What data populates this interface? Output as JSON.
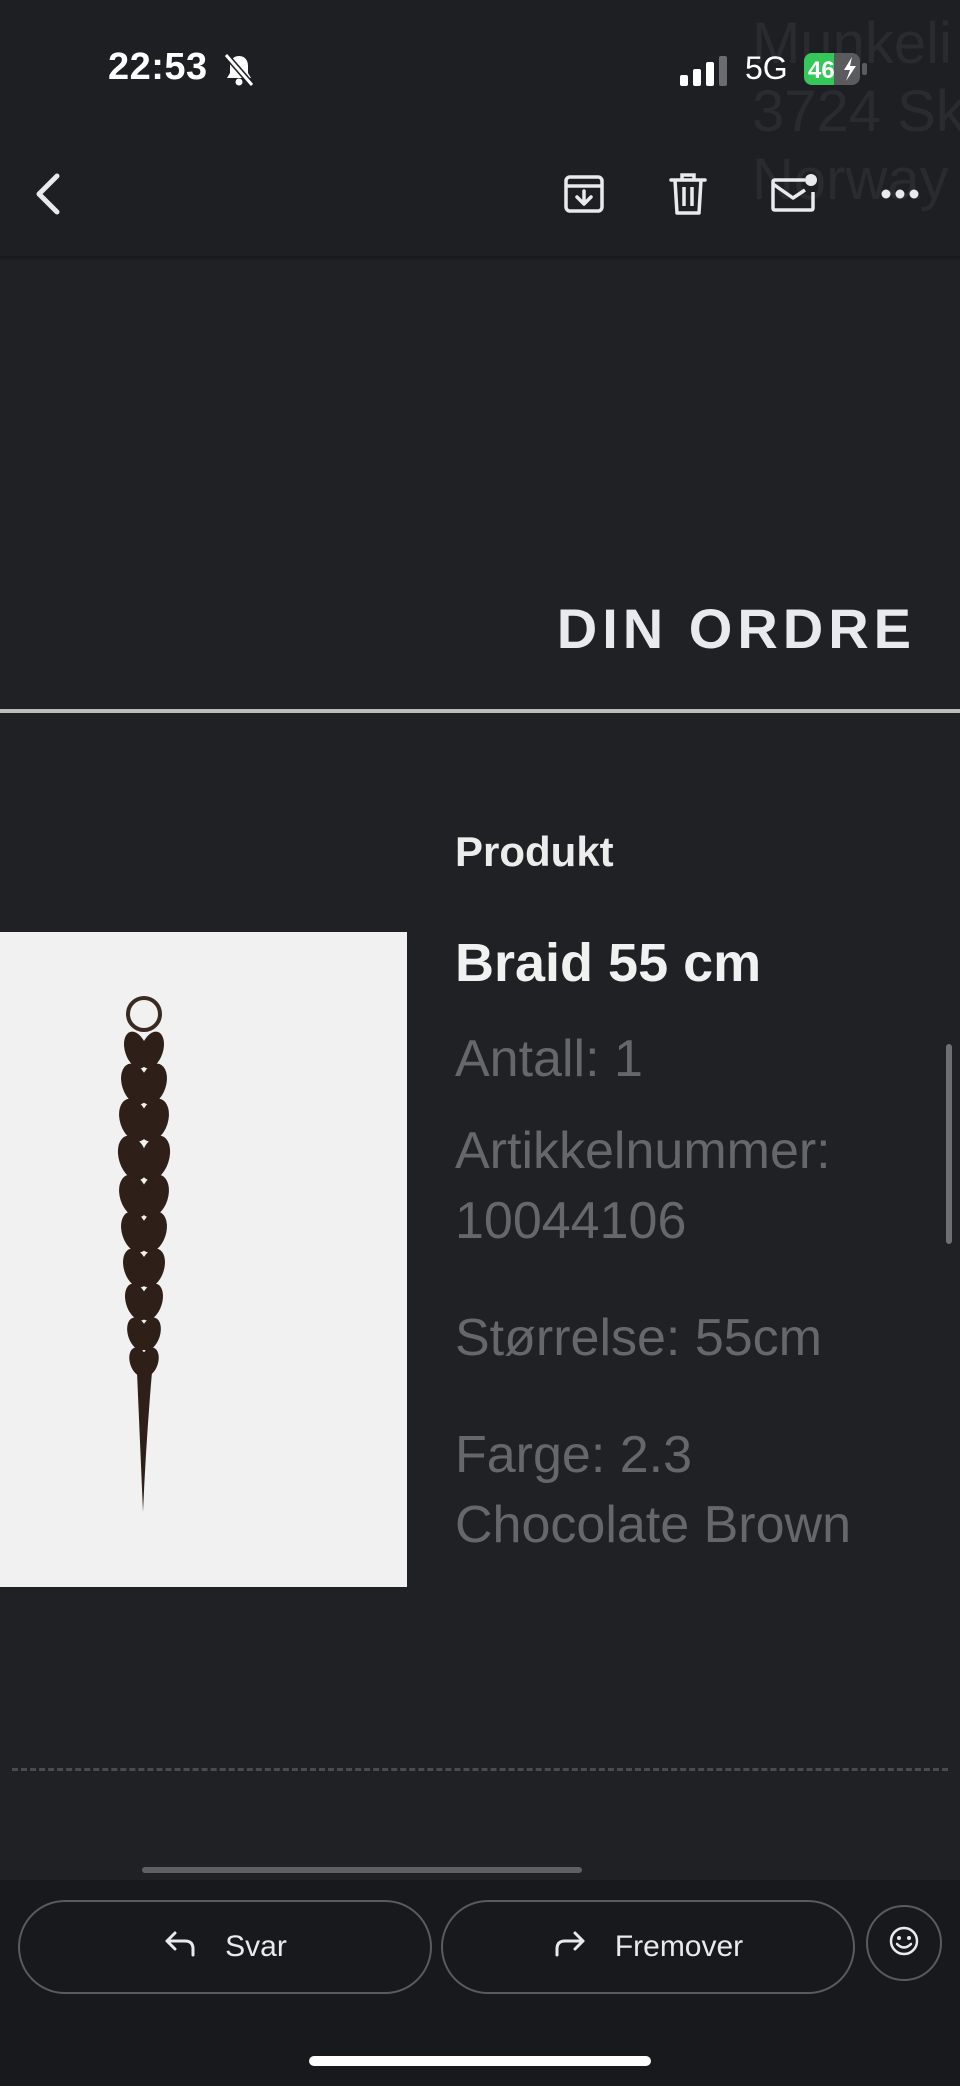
{
  "status_bar": {
    "time": "22:53",
    "network": "5G",
    "battery": "46",
    "icons": [
      "bell-slash-icon",
      "signal-icon",
      "battery-charging-icon"
    ]
  },
  "background_text": "Munkeli\n3724 Sk\nNorway",
  "toolbar": {
    "icons": [
      "back-arrow-icon",
      "archive-icon",
      "trash-icon",
      "mark-unread-icon",
      "more-icon"
    ]
  },
  "email": {
    "heading": "DIN ORDRE",
    "product_label": "Produkt",
    "product_name": "Braid 55 cm",
    "quantity": "Antall: 1",
    "article_number": "Artikkelnummer: 10044106",
    "size": "Størrelse: 55cm",
    "color": "Farge: 2.3 Chocolate Brown"
  },
  "actions": {
    "reply_label": "Svar",
    "forward_label": "Fremover",
    "icons": [
      "reply-icon",
      "forward-icon",
      "emoji-icon"
    ]
  },
  "colors": {
    "background": "#202124",
    "battery_green": "#34c759",
    "detail_text": "#66676b"
  }
}
